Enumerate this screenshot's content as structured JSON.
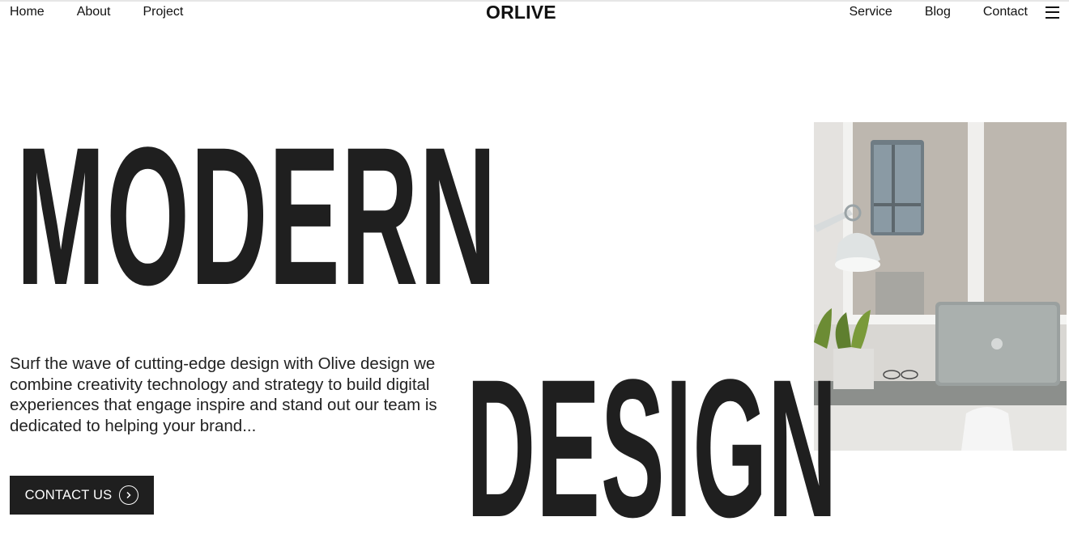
{
  "nav": {
    "left": [
      "Home",
      "About",
      "Project"
    ],
    "logo": "ORLIVE",
    "right": [
      "Service",
      "Blog",
      "Contact"
    ],
    "menu_icon": "hamburger-menu-icon"
  },
  "hero": {
    "headline_line1": "MODERN",
    "headline_line2": "DESIGN",
    "intro": "Surf the wave of cutting-edge design with Olive design we combine creativity technology and strategy to build digital experiences that engage inspire and stand out our team is dedicated to helping your brand...",
    "cta_label": "CONTACT US",
    "cta_icon": "chevron-right-circle-icon"
  },
  "colors": {
    "text_dark": "#1f1f1f",
    "button_bg": "#1f1f1f",
    "button_text": "#ffffff",
    "background": "#ffffff"
  }
}
